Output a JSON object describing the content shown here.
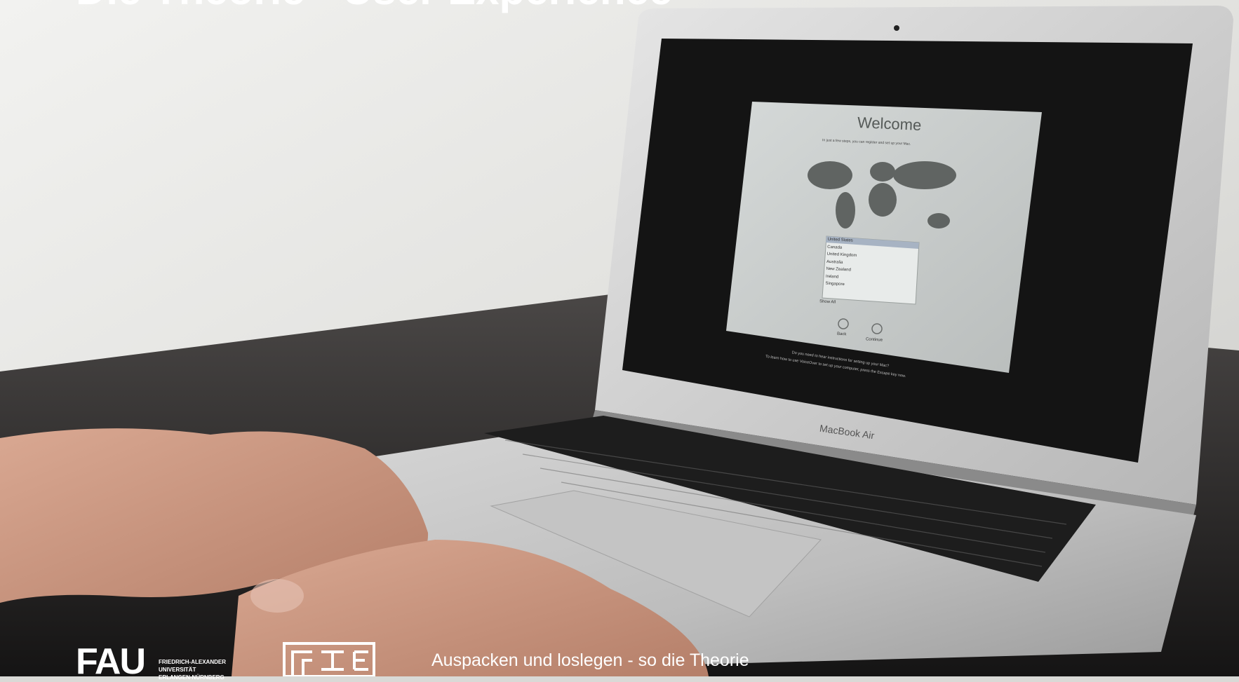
{
  "slide": {
    "title": "Die Theorie - User Experience",
    "caption": "Auspacken und loslegen - so die Theorie"
  },
  "laptop": {
    "brand_label": "MacBook Air",
    "screen": {
      "heading": "Welcome",
      "subtitle": "In just a few steps, you can register and set up your Mac.",
      "countries": [
        "United States",
        "Canada",
        "United Kingdom",
        "Australia",
        "New Zealand",
        "Ireland",
        "Singapore"
      ],
      "show_all_label": "Show All",
      "back_label": "Back",
      "continue_label": "Continue",
      "help_line1": "Do you need to hear instructions for setting up your Mac?",
      "help_line2": "To learn how to use VoiceOver to set up your computer, press the Escape key now."
    }
  },
  "footer": {
    "fau_mark": "FAU",
    "fau_lines": [
      "FRIEDRICH-ALEXANDER",
      "UNIVERSITÄT",
      "ERLANGEN-NÜRNBERG"
    ]
  }
}
